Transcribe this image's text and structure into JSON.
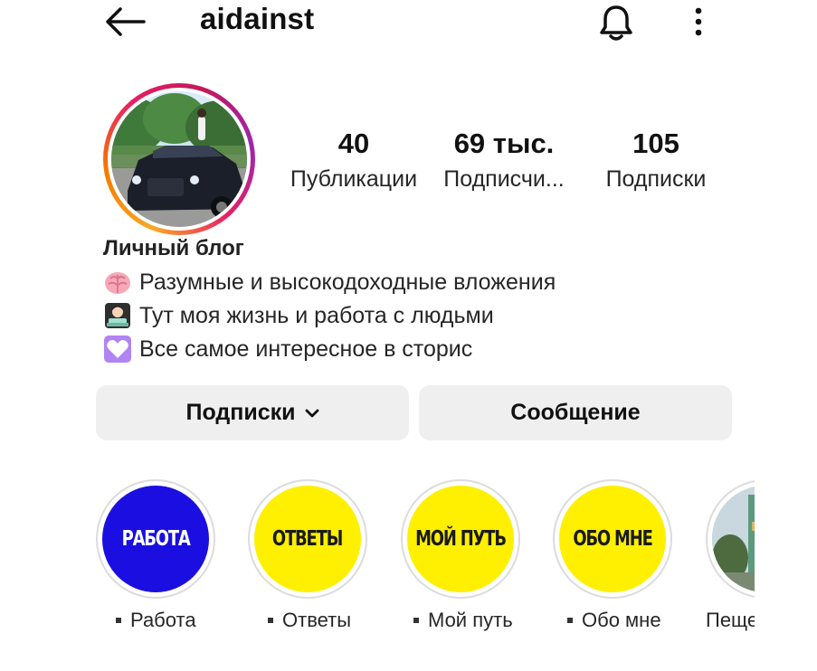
{
  "header": {
    "username": "aidainst",
    "back_icon": "arrow-left-icon",
    "bell_icon": "bell-icon",
    "more_icon": "more-vertical-icon"
  },
  "stats": [
    {
      "value": "40",
      "label": "Публикации"
    },
    {
      "value": "69 тыс.",
      "label": "Подписчи..."
    },
    {
      "value": "105",
      "label": "Подписки"
    }
  ],
  "bio": {
    "name": "Личный блог",
    "lines": [
      {
        "icon": "brain-emoji",
        "text": "Разумные и высокодоходные вложения"
      },
      {
        "icon": "technologist-emoji",
        "text": "Тут моя жизнь и работа с людьми"
      },
      {
        "icon": "heart-emoji",
        "text": "Все самое интересное в сторис"
      }
    ]
  },
  "buttons": {
    "following": "Подписки",
    "following_icon": "chevron-down-icon",
    "message": "Сообщение"
  },
  "highlights": [
    {
      "cover_text": "РАБОТА",
      "label": "Работа",
      "bg": "#1a0fe0",
      "fg": "#ffffff"
    },
    {
      "cover_text": "ОТВЕТЫ",
      "label": "Ответы",
      "bg": "#ffef00",
      "fg": "#1a1a1a"
    },
    {
      "cover_text": "МОЙ ПУТЬ",
      "label": "Мой путь",
      "bg": "#ffef00",
      "fg": "#1a1a1a"
    },
    {
      "cover_text": "ОБО МНЕ",
      "label": "Обо мне",
      "bg": "#ffef00",
      "fg": "#1a1a1a"
    },
    {
      "cover_text": "",
      "label": "Пеще",
      "bg": "#9fb8c4",
      "fg": "#ffffff"
    }
  ]
}
